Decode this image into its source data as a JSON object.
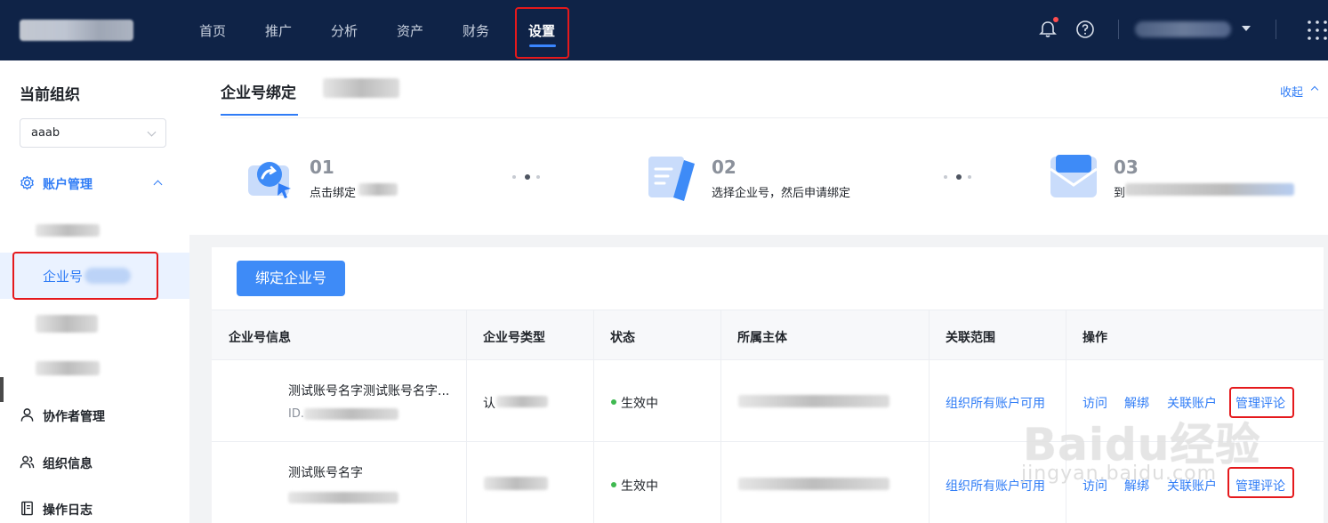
{
  "nav": {
    "items": [
      "首页",
      "推广",
      "分析",
      "资产",
      "财务",
      "设置"
    ],
    "active": "设置"
  },
  "sidebar": {
    "title": "当前组织",
    "org_value": "aaab",
    "groups": {
      "account": "账户管理",
      "collab": "协作者管理",
      "org_info": "组织信息",
      "log": "操作日志"
    },
    "active_item": "企业号"
  },
  "header": {
    "tab": "企业号绑定",
    "collapse": "收起",
    "steps": [
      {
        "num": "01",
        "desc": "点击绑定"
      },
      {
        "num": "02",
        "desc": "选择企业号，然后申请绑定"
      },
      {
        "num": "03",
        "desc": "到"
      }
    ]
  },
  "main": {
    "bind_button": "绑定企业号",
    "columns": [
      "企业号信息",
      "企业号类型",
      "状态",
      "所属主体",
      "关联范围",
      "操作"
    ],
    "rows": [
      {
        "name": "测试账号名字测试账号名字...",
        "id_prefix": "ID.",
        "type": "认",
        "status": "生效中",
        "scope": "组织所有账户可用",
        "ops": [
          "访问",
          "解绑",
          "关联账户",
          "管理评论"
        ]
      },
      {
        "name": "测试账号名字",
        "id_prefix": "",
        "type": "",
        "status": "生效中",
        "scope": "组织所有账户可用",
        "ops": [
          "访问",
          "解绑",
          "关联账户",
          "管理评论"
        ]
      }
    ]
  },
  "watermark": {
    "logo": "Baidu经验",
    "url": "jingyan.baidu.com"
  },
  "colors": {
    "nav_bg": "#0f2347",
    "accent": "#2f7cf6",
    "highlight": "#e5191c",
    "status_ok": "#3fb950"
  }
}
